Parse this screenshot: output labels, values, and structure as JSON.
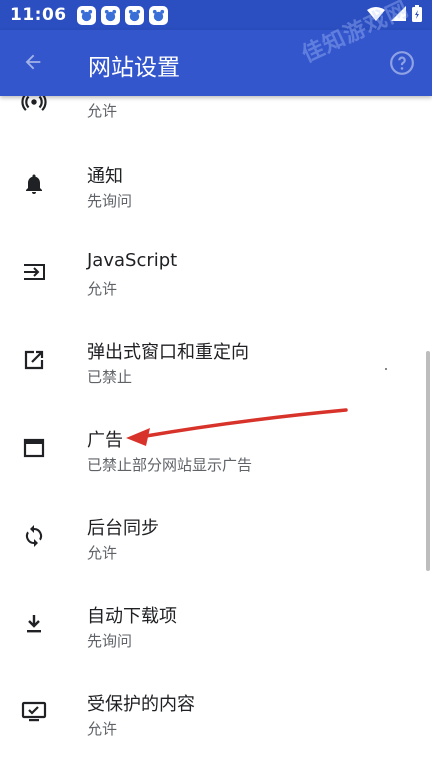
{
  "status_bar": {
    "time": "11:06"
  },
  "header": {
    "title": "网站设置",
    "watermark": "佳知游戏网"
  },
  "settings": [
    {
      "key": "partial",
      "subtitle": "允许",
      "icon": "sensors-icon"
    },
    {
      "key": "notifications",
      "title": "通知",
      "subtitle": "先询问",
      "icon": "bell-icon"
    },
    {
      "key": "javascript",
      "title": "JavaScript",
      "subtitle": "允许",
      "icon": "javascript-icon"
    },
    {
      "key": "popups",
      "title": "弹出式窗口和重定向",
      "subtitle": "已禁止",
      "icon": "open-external-icon"
    },
    {
      "key": "ads",
      "title": "广告",
      "subtitle": "已禁止部分网站显示广告",
      "icon": "browser-window-icon"
    },
    {
      "key": "background_sync",
      "title": "后台同步",
      "subtitle": "允许",
      "icon": "sync-icon"
    },
    {
      "key": "auto_downloads",
      "title": "自动下载项",
      "subtitle": "先询问",
      "icon": "download-icon"
    },
    {
      "key": "protected_content",
      "title": "受保护的内容",
      "subtitle": "允许",
      "icon": "protected-content-icon"
    }
  ],
  "colors": {
    "header": "#3456cc",
    "status": "#2b4ec0",
    "annotation_arrow": "#d8332a"
  }
}
